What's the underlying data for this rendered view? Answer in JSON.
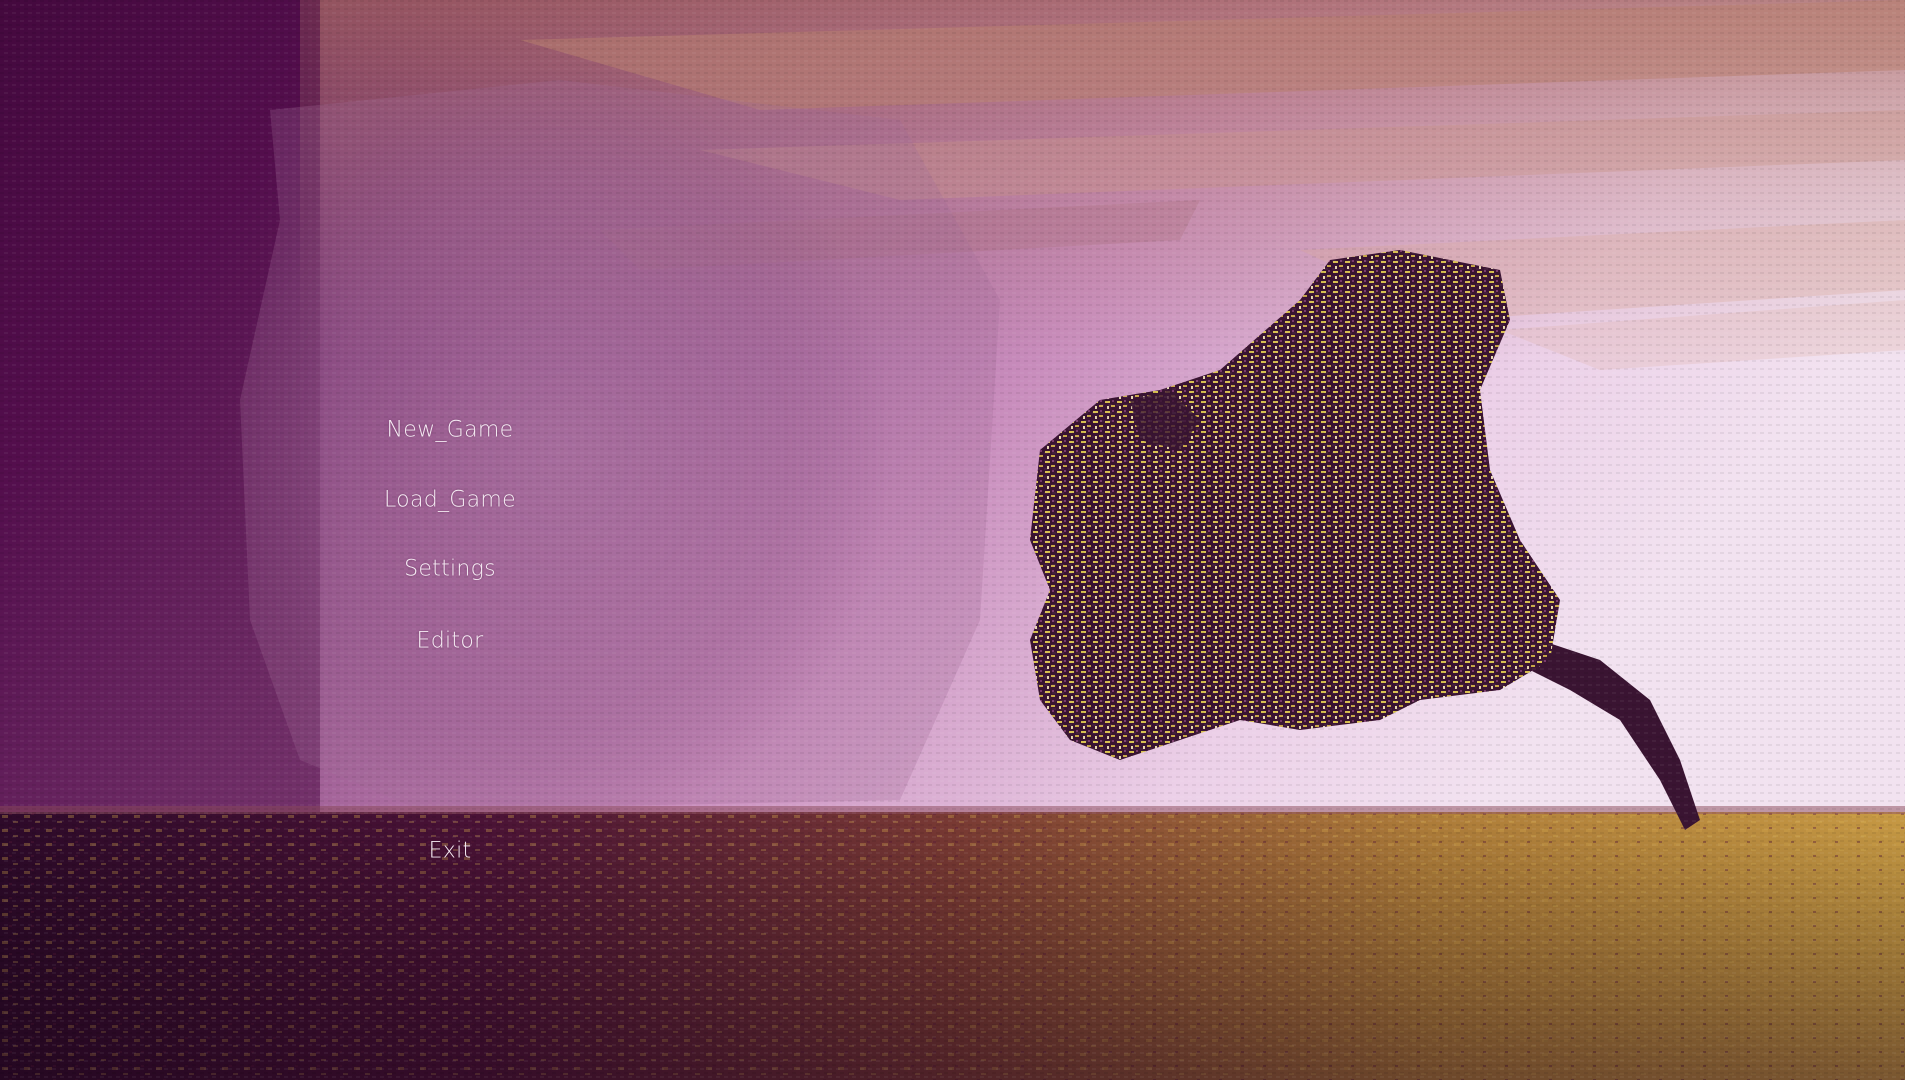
{
  "menu": {
    "new_game": "New_Game",
    "load_game": "Load_Game",
    "settings": "Settings",
    "editor": "Editor",
    "exit": "Exit"
  },
  "background": {
    "description_icon": "lone-tree-landscape",
    "colors": {
      "sky_dark": "#5a1450",
      "sky_mid": "#9a5a8e",
      "sky_light": "#e8c4e0",
      "cloud_warm": "#c4907e",
      "field_dark": "#3a1030",
      "field_gold": "#c89a3a",
      "tree_dark": "#3a1432",
      "tree_gold": "#d8c050"
    }
  }
}
